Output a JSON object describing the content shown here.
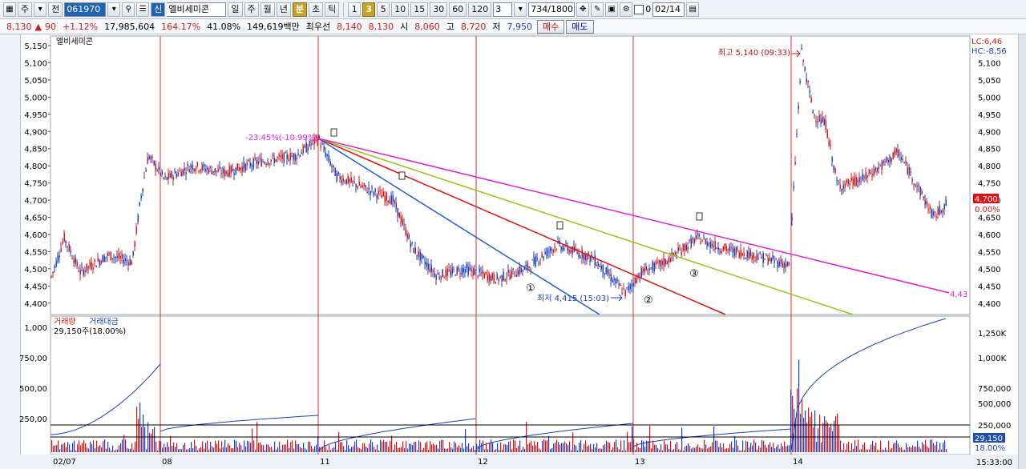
{
  "toolbar": {
    "stock_type": "주",
    "prev_btn": "전",
    "code": "061970",
    "name": "엘비세미콘",
    "period_tabs": [
      "일",
      "주",
      "월",
      "년",
      "분",
      "초",
      "틱"
    ],
    "active_period": "분",
    "intervals": [
      "1",
      "3",
      "5",
      "10",
      "15",
      "30",
      "60",
      "120"
    ],
    "active_interval": "3",
    "interval_value": "3",
    "count": "734",
    "count_total": "/1800",
    "chk_label": "0",
    "date": "02/14",
    "new_label": "신"
  },
  "quote": {
    "price": "8,130",
    "change": "90",
    "rate": "+1.12%",
    "volume": "17,985,604",
    "ratio1": "164.17%",
    "ratio2": "41.08%",
    "amount": "149,619백만",
    "best_label": "최우선",
    "best_ask": "8,140",
    "best_bid": "8,130",
    "open_label": "시",
    "open": "8,060",
    "high_label": "고",
    "high": "8,720",
    "low_label": "저",
    "low": "7,950",
    "buy_btn": "매수",
    "sell_btn": "매도"
  },
  "chart": {
    "stock_label": "엘비세미콘",
    "lc": "LC:6,46",
    "hc": "HC:-8,56",
    "price_ticks": [
      "5,150",
      "5,100",
      "5,050",
      "5,000",
      "4,950",
      "4,900",
      "4,850",
      "4,800",
      "4,750",
      "4,700",
      "4,650",
      "4,600",
      "4,550",
      "4,500",
      "4,450",
      "4,400"
    ],
    "right_ticks": [
      "5,100",
      "5,050",
      "5,000",
      "4,950",
      "4,900",
      "4,850",
      "4,800",
      "4,750",
      "4,700",
      "4,650",
      "4,600",
      "4,550",
      "4,500",
      "4,450",
      "4,400"
    ],
    "current_price": "4,700",
    "current_pct": "0.00%",
    "high_annot": "최고 5,140 (09:33)",
    "low_annot": "최저 4,415 (15:03)",
    "start_annot": "-23.45%(-10.99%)",
    "trend_end_label": "4,43",
    "circle_labels": [
      "①",
      "②",
      "③"
    ],
    "dates": [
      "02/07",
      "08",
      "11",
      "12",
      "13",
      "14"
    ],
    "vol_title": "거래량",
    "amt_title": "거래대금",
    "vol_value": "29,150주(18.00%)",
    "vol_ticks": [
      "1,000",
      "750,00",
      "500,00",
      "250,00"
    ],
    "amt_ticks": [
      "1,250K",
      "1,000K",
      "750,000",
      "500,000",
      "250,000"
    ],
    "vol_current": "29,150",
    "vol_current_pct": "18.00%",
    "time_label": "15:33:00"
  },
  "colors": {
    "up": "#d01818",
    "down": "#1a3fc0",
    "trend_blue": "#1f5fd6",
    "trend_red": "#e01010",
    "trend_green": "#9ac21a",
    "trend_magenta": "#e020e0",
    "vline": "#d83030"
  }
}
